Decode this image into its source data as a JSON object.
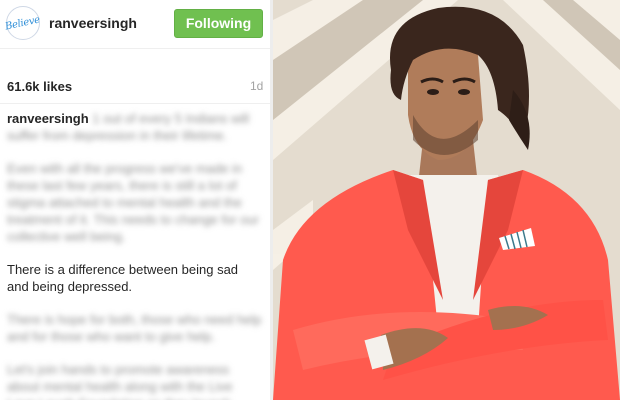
{
  "post": {
    "avatar_text": "Believe",
    "username": "ranveersingh",
    "follow_label": "Following",
    "likes": "61.6k likes",
    "time_ago": "1d",
    "caption": {
      "user": "ranveersingh",
      "p1": "1 out of every 5 Indians will suffer from depression in their lifetime.",
      "p2": "Even with all the progress we've made in these last few years, there is still a lot of stigma attached to mental health and the treatment of it. This needs to change for our collective well being.",
      "p3": "There is a difference between being sad and being depressed.",
      "p4": "There is hope for both, those who need help and for those who want to give help.",
      "p5": "Let's join hands to promote awareness about mental health along with the Live Love Laugh Foundation as they launch"
    }
  },
  "colors": {
    "follow_button": "#70c050",
    "jacket": "#ff5a4e",
    "background_wall": "#e6dfd4"
  }
}
